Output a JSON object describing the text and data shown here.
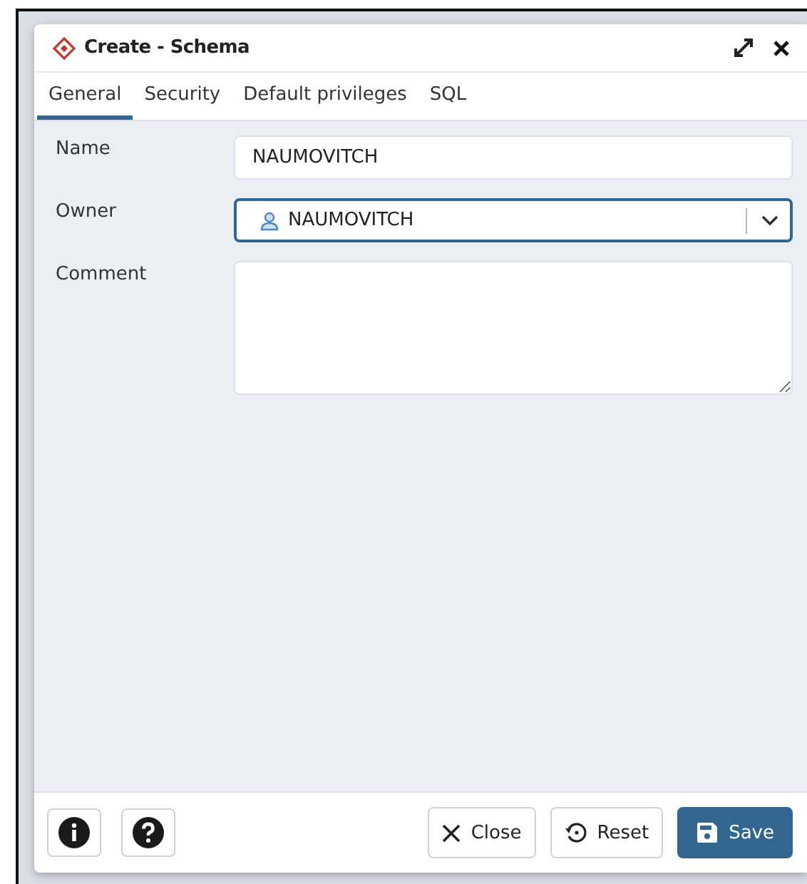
{
  "window": {
    "title": "Create - Schema"
  },
  "tabs": [
    {
      "label": "General",
      "selected": true
    },
    {
      "label": "Security",
      "selected": false
    },
    {
      "label": "Default privileges",
      "selected": false
    },
    {
      "label": "SQL",
      "selected": false
    }
  ],
  "fields": [
    {
      "kind": "text",
      "label": "Name",
      "value": "NAUMOVITCH",
      "focused": false
    },
    {
      "kind": "select",
      "label": "Owner",
      "value": "NAUMOVITCH",
      "focused": true
    },
    {
      "kind": "textarea",
      "label": "Comment",
      "focused": false
    }
  ],
  "buttons": [
    {
      "label": "Close",
      "kind": "close",
      "primary": false
    },
    {
      "label": "Reset",
      "kind": "reset",
      "primary": false
    },
    {
      "label": "Save",
      "kind": "save",
      "primary": true
    }
  ]
}
